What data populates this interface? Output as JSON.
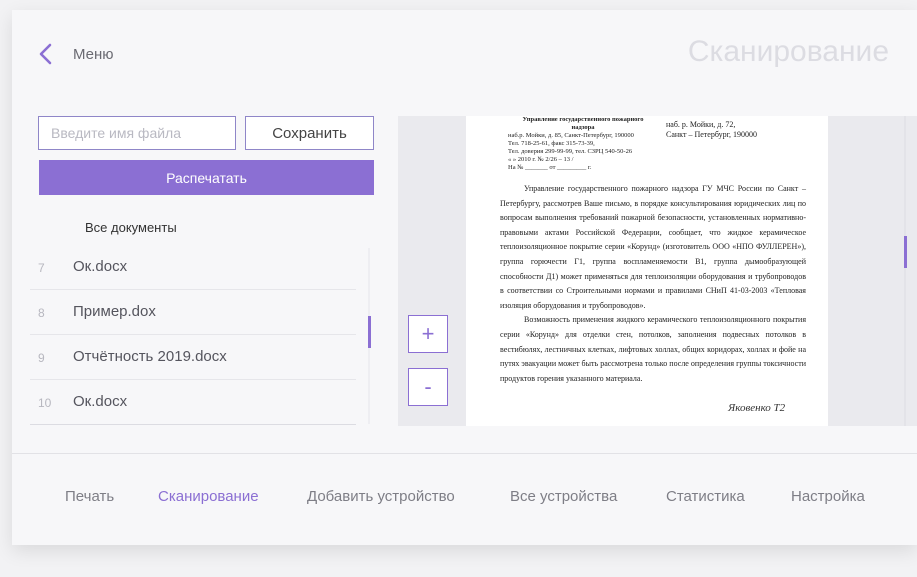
{
  "header": {
    "back_label": "Меню",
    "title": "Сканирование"
  },
  "file": {
    "placeholder": "Введите имя файла",
    "save_label": "Сохранить",
    "print_label": "Распечатать"
  },
  "documents": {
    "title": "Все документы",
    "items": [
      {
        "num": "7",
        "name": "Ок.docx"
      },
      {
        "num": "8",
        "name": "Пример.dox"
      },
      {
        "num": "9",
        "name": "Отчётность 2019.docx"
      },
      {
        "num": "10",
        "name": "Ок.docx"
      }
    ]
  },
  "viewer": {
    "zoom_in": "+",
    "zoom_out": "-",
    "scan": {
      "org_lines": [
        "Управление государственного пожарного",
        "надзора"
      ],
      "addr_lines": [
        "наб.р. Мойки, д. 85, Санкт-Петербург, 190000",
        "Тел. 718-25-61, факс 315-73-39,",
        "Тел. доверия 299-99-99, тел. СЗРЦ 540-50-26"
      ],
      "date_line": "« » 2010 г. № 2/26 – 13 /",
      "ref_line": "На № _______ от _________ г.",
      "recipient_lines": [
        "наб. р. Мойки, д. 72,",
        "Санкт – Петербург, 190000"
      ],
      "paragraphs": [
        "Управление государственного пожарного надзора ГУ МЧС России по Санкт – Петербургу, рассмотрев Ваше письмо, в порядке консультирования юридических лиц по вопросам выполнения требований пожарной безопасности, установленных нормативно-правовыми актами Российской Федерации, сообщает, что жидкое керамическое теплоизоляционное покрытие серии «Корунд» (изготовитель ООО «НПО ФУЛЛЕРЕН»), группа горючести Г1, группа воспламеняемости В1, группа дымообразующей способности Д1) может применяться для теплоизоляции оборудования и трубопроводов в соответствии со Строительными нормами и правилами СНиП 41-03-2003 «Тепловая изоляция оборудования и трубопроводов».",
        "Возможность применения жидкого керамического теплоизоляционного покрытия серии «Корунд» для отделки стен, потолков, заполнения подвесных потолков в вестибюлях, лестничных клетках, лифтовых холлах, общих коридорах, холлах и фойе на путях эвакуации может быть рассмотрена только после определения группы токсичности продуктов горения указанного материала."
      ],
      "signature": "Яковенко Т2"
    }
  },
  "nav": {
    "items": [
      "Печать",
      "Сканирование",
      "Добавить устройство",
      "Все устройства",
      "Статистика",
      "Настройка"
    ],
    "active": "Сканирование"
  },
  "colors": {
    "accent": "#8b6fd3",
    "title": "#dcdce2"
  }
}
